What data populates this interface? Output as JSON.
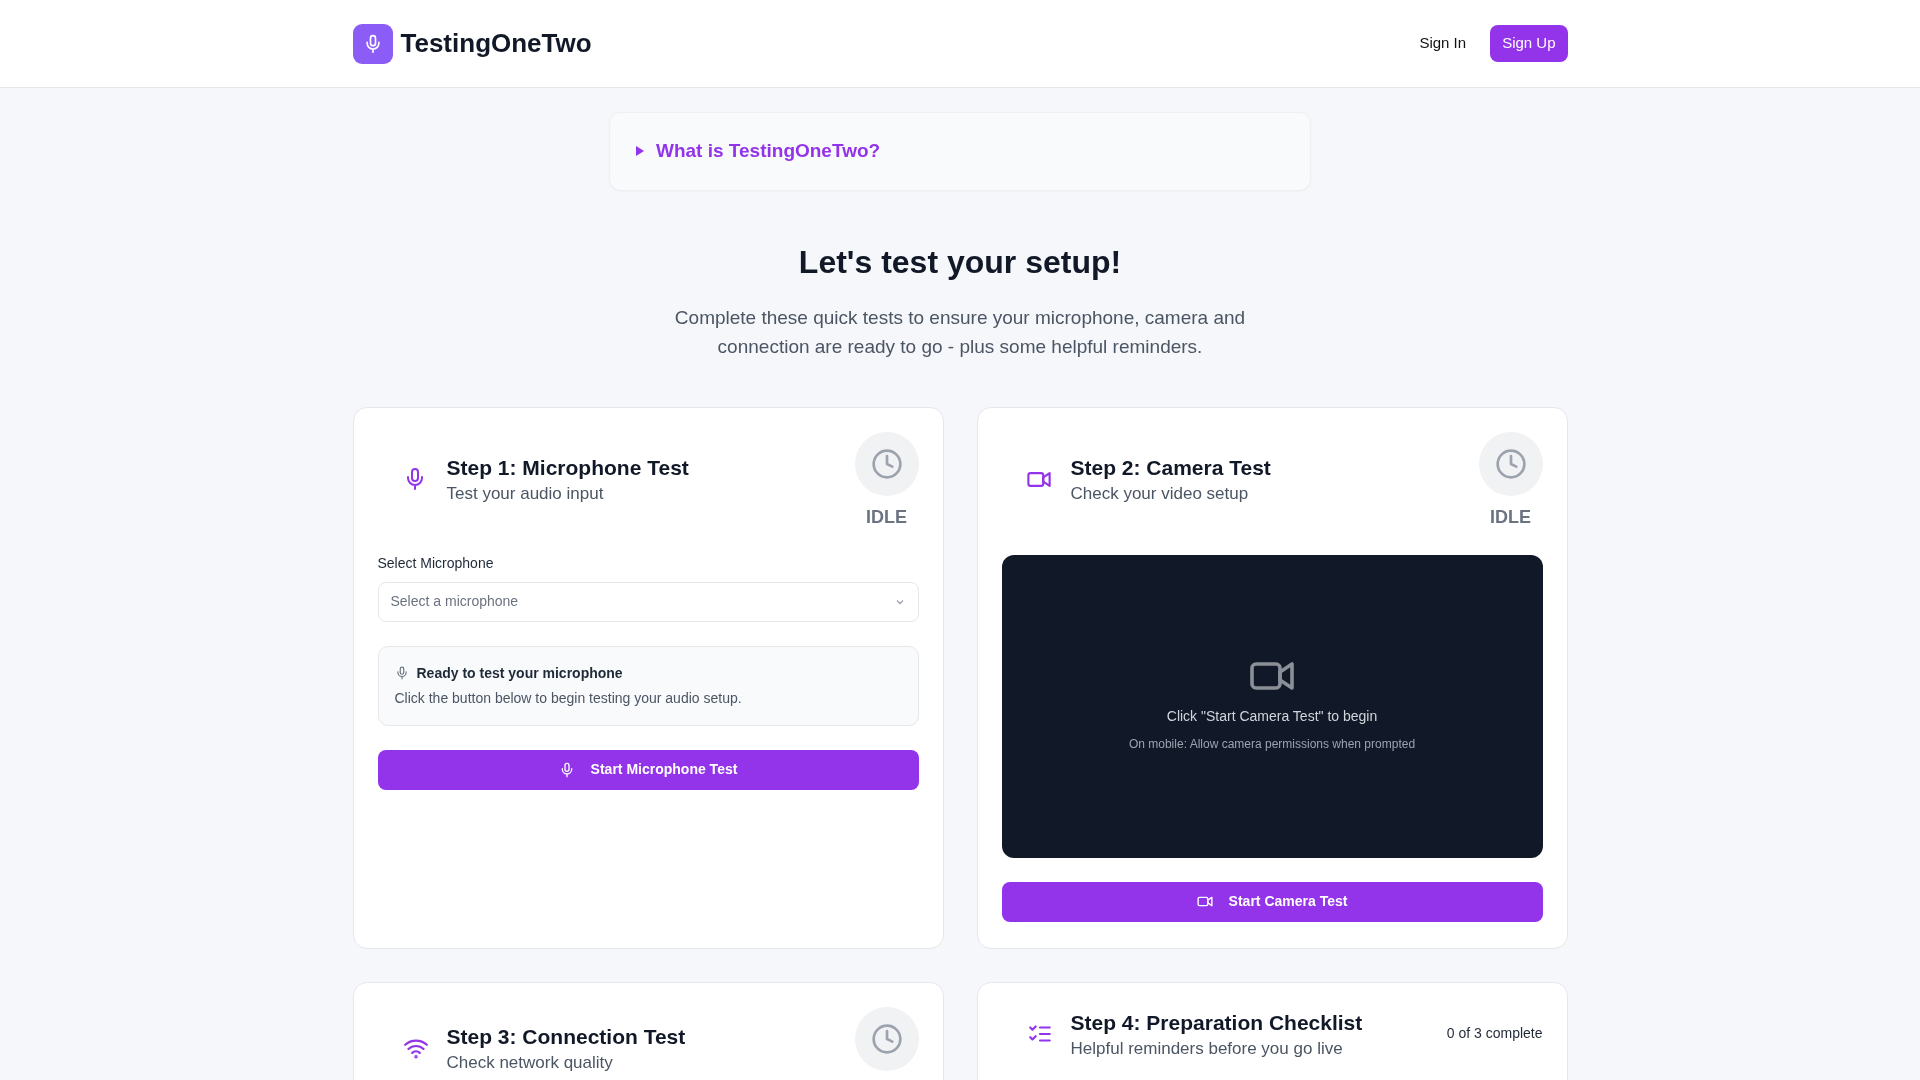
{
  "header": {
    "brand": "TestingOneTwo",
    "links": [
      {
        "label": "Sign In",
        "kind": "link"
      },
      {
        "label": "Sign Up",
        "kind": "primary"
      }
    ]
  },
  "about": {
    "summary": "What is TestingOneTwo?",
    "expanded": false
  },
  "intro": {
    "title": "Let's test your setup!",
    "text": "Complete these quick tests to ensure your microphone, camera and connection are ready to go - plus some helpful reminders."
  },
  "cards": [
    {
      "kind": "microphone",
      "title": "Step 1: Microphone Test",
      "subtitle": "Test your audio input",
      "status": "IDLE",
      "select": {
        "label": "Select Microphone",
        "placeholder": "Select a microphone"
      },
      "info": {
        "title": "Ready to test your microphone",
        "text": "Click the button below to begin testing your audio setup."
      },
      "button": "Start Microphone Test"
    },
    {
      "kind": "camera",
      "title": "Step 2: Camera Test",
      "subtitle": "Check your video setup",
      "status": "IDLE",
      "preview": {
        "title": "Click \"Start Camera Test\" to begin",
        "note": "On mobile: Allow camera permissions when prompted"
      },
      "button": "Start Camera Test"
    },
    {
      "kind": "connection",
      "title": "Step 3: Connection Test",
      "subtitle": "Check network quality"
    },
    {
      "kind": "checklist",
      "title": "Step 4: Preparation Checklist",
      "subtitle": "Helpful reminders before you go live",
      "progress": "0 of 3 complete"
    }
  ]
}
